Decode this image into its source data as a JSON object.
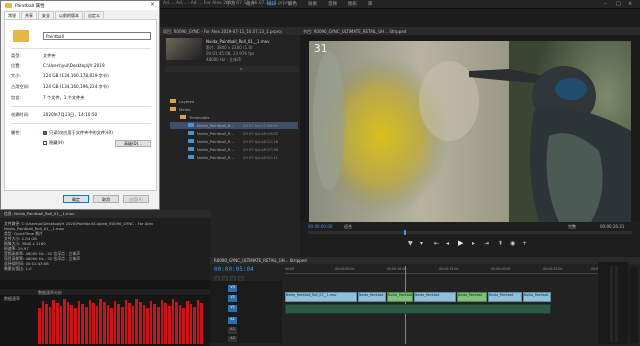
{
  "app": {
    "title": "Ad ... Ad... - Ad ... For Alex 2019-07-11_16.07.13_1.prproj *",
    "workspaces": [
      "学习",
      "组件",
      "编辑",
      "颜色",
      "效果",
      "音频",
      "图形",
      "库"
    ],
    "active_workspace": "编辑"
  },
  "dialog": {
    "title": "Paintball 属性",
    "tabs": [
      "常规",
      "共享",
      "安全",
      "以前的版本",
      "自定义"
    ],
    "name_value": "Paintball",
    "rows": [
      {
        "k": "类型:",
        "v": "文件夹"
      },
      {
        "k": "位置:",
        "v": "C:\\Users\\yul\\Desktop\\jfr 2019"
      },
      {
        "k": "大小:",
        "v": "124 GB (134,160,178,819 字节)"
      },
      {
        "k": "占用空间:",
        "v": "124 GB (134,160,196,224 字节)"
      },
      {
        "k": "包含:",
        "v": "7 个文件，1 个文件夹"
      },
      {
        "k": "创建时间:",
        "v": "2020年7月13日，14:10:50"
      },
      {
        "k": "属性:",
        "v": ""
      }
    ],
    "cb_readonly": "只读(仅应用于文件夹中的文件)(R)",
    "cb_hidden": "隐藏(H)",
    "advanced_label": "高级(D)...",
    "ok_label": "确定",
    "cancel_label": "取消",
    "apply_label": "应用(A)"
  },
  "project": {
    "tab_label": "项目: R0090_GYNC - For Alex 2019-07-11_16.07.13_1.prproj",
    "clip_name": "Nvida_Paintball_Roll_01__1.mov",
    "clip_meta1": "影片, 3840 x 2160 (1.0)",
    "clip_meta2": "00:01:45:08, 23.976 fps",
    "clip_meta3": "48000 Hz - 立体声",
    "rows": [
      {
        "icon": "bin",
        "name": "Layered",
        "rate": "",
        "start": ""
      },
      {
        "icon": "bin",
        "name": "Media",
        "rate": "",
        "start": ""
      },
      {
        "icon": "bin",
        "name": "Timecodes",
        "rate": "",
        "start": ""
      },
      {
        "icon": "clip",
        "name": "Nvida_Paintball_R...",
        "rate": "29.97 fps",
        "start": "17:48:00",
        "selected": true
      },
      {
        "icon": "clip",
        "name": "Nvida_Paintball_R...",
        "rate": "29.97 fps",
        "start": "18:09:02"
      },
      {
        "icon": "clip",
        "name": "Nvida_Paintball_R...",
        "rate": "29.97 fps",
        "start": "18:22:16"
      },
      {
        "icon": "clip",
        "name": "Nvida_Paintball_R...",
        "rate": "29.97 fps",
        "start": "18:37:38"
      },
      {
        "icon": "clip",
        "name": "Nvida_Paintball_R...",
        "rate": "29.97 fps",
        "start": "18:52:11"
      }
    ]
  },
  "program": {
    "tab_label": "节目: R0090_GYNC_ULTIMATE_RETAIL_UH... Stripped",
    "frame_number": "31",
    "timecode_in": "00:00:00:00",
    "fit_label": "适合",
    "quality": "完整",
    "timecode_out": "00:00:26:21"
  },
  "info": {
    "tab_label": "信息: Nvida_Paintball_Roll_01__1.mov",
    "lines": [
      "文件路径: C:\\Users\\ai\\Desktop\\jfr 2020\\Paintball\\Copied_R0090_GYNC - For Alex",
      "Nvida_Paintball_Roll_01__1.mov",
      "类型: QuickTime 影片",
      "文件大小: 2.04 GB",
      "图像大小: 3840 x 2160",
      "帧速率: 29.97",
      "音频采样率: 48000 Hz - 32 位浮点 - 立体声",
      "项目采样率: 48000 Hz - 32 位浮点 - 立体声",
      "总持续时间: 00:01:43:08",
      "像素长宽比: 1.0"
    ]
  },
  "meter": {
    "label_left": "数据速率",
    "label_right": "数据速率分析",
    "bars_count": 46
  },
  "timeline": {
    "tab_label": "R0090_GYNC_ULTIMATE_RETAIL_UH... Stripped",
    "timecode": "00:00:05:04",
    "tracks": [
      "V3",
      "V2",
      "V1",
      "A1",
      "A2",
      "A3"
    ],
    "ruler": [
      "00:00",
      "00:00:05:00",
      "00:00:10:00",
      "00:00:15:00",
      "00:00:20:00",
      "00:00:25:00",
      "00:00:30:00"
    ],
    "clips": [
      {
        "label": "Nvida_Paintball_Roll_01__1.mov",
        "color": "blue"
      },
      {
        "label": "Nvida_Paintball",
        "color": "blue"
      },
      {
        "label": "Nvida_Paintball",
        "color": "green"
      },
      {
        "label": "Nvida_Paintball",
        "color": "blue"
      },
      {
        "label": "Nvida_Paintball",
        "color": "green"
      },
      {
        "label": "Nvida_Paintball",
        "color": "blue"
      },
      {
        "label": "Nvida_Paintball",
        "color": "blue"
      }
    ]
  }
}
